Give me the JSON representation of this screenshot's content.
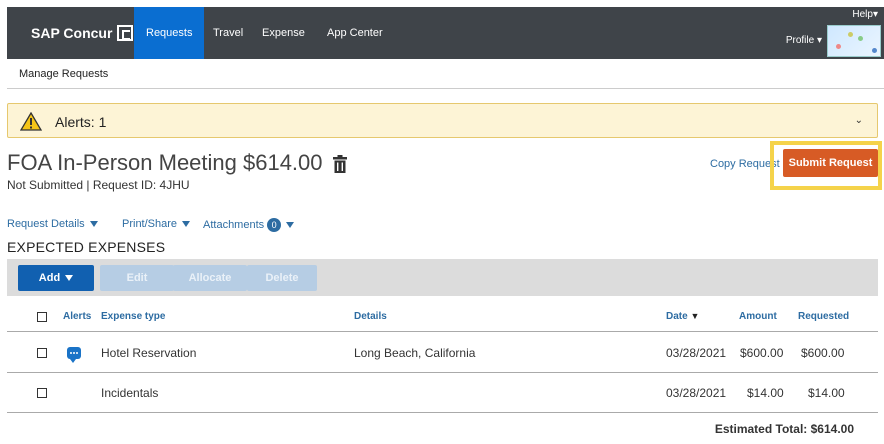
{
  "nav": {
    "brand": "SAP Concur",
    "tabs": [
      "Requests",
      "Travel",
      "Expense",
      "App Center"
    ],
    "help": "Help",
    "profile": "Profile"
  },
  "subnav": {
    "manage": "Manage Requests"
  },
  "alerts": {
    "label": "Alerts: 1"
  },
  "request": {
    "title": "FOA In-Person Meeting $614.00",
    "status": "Not Submitted",
    "id_text": "Request ID: 4JHU",
    "copy_label": "Copy Request",
    "submit_label": "Submit Request"
  },
  "menus": {
    "details": "Request Details",
    "print": "Print/Share",
    "attachments": "Attachments",
    "attachments_count": "0"
  },
  "section_title": "EXPECTED EXPENSES",
  "toolbar": {
    "add": "Add",
    "edit": "Edit",
    "allocate": "Allocate",
    "delete": "Delete"
  },
  "columns": {
    "alerts": "Alerts",
    "type": "Expense type",
    "details": "Details",
    "date": "Date",
    "amount": "Amount",
    "requested": "Requested"
  },
  "rows": [
    {
      "type": "Hotel Reservation",
      "details": "Long Beach, California",
      "date": "03/28/2021",
      "amount": "$600.00",
      "requested": "$600.00"
    },
    {
      "type": "Incidentals",
      "details": "",
      "date": "03/28/2021",
      "amount": "$14.00",
      "requested": "$14.00"
    }
  ],
  "total": "Estimated Total: $614.00",
  "colors": {
    "nav_bg": "#3f4449",
    "active_tab": "#0a6ed1",
    "submit": "#d75b25",
    "highlight": "#f5d34a",
    "link": "#2d6ca2"
  }
}
